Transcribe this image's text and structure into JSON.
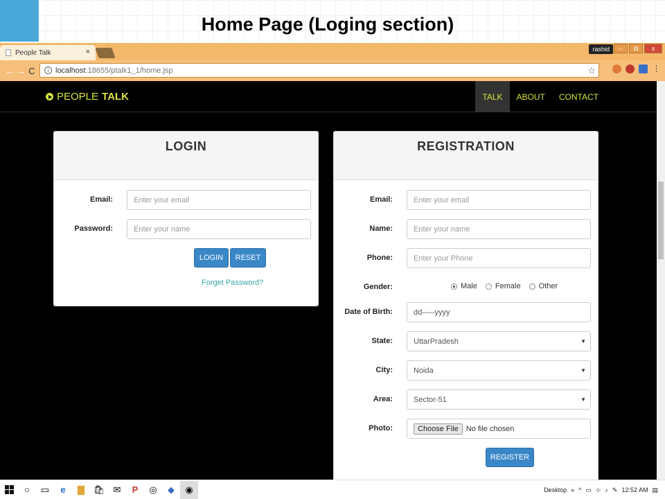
{
  "slide": {
    "title": "Home Page (Loging section)"
  },
  "browser": {
    "tab_title": "People Talk",
    "tab_close": "×",
    "user": "rashid",
    "url_host": "localhost",
    "url_path": ":18655/ptalk1_1/home.jsp",
    "win_min": "–",
    "win_max": "⧉",
    "win_close": "x"
  },
  "navbar": {
    "brand_light": "PEOPLE",
    "brand_bold": "TALK",
    "menu": [
      "TALK",
      "ABOUT",
      "CONTACT"
    ],
    "active": "TALK"
  },
  "login": {
    "title": "LOGIN",
    "email_label": "Email:",
    "email_placeholder": "Enter your email",
    "password_label": "Password:",
    "password_placeholder": "Enter your name",
    "login_button": "LOGIN",
    "reset_button": "RESET",
    "forgot_link": "Forget Password?"
  },
  "registration": {
    "title": "REGISTRATION",
    "email_label": "Email:",
    "email_placeholder": "Enter your email",
    "name_label": "Name:",
    "name_placeholder": "Enter your name",
    "phone_label": "Phone:",
    "phone_placeholder": "Enter your Phone",
    "gender_label": "Gender:",
    "gender_options": [
      "Male",
      "Female",
      "Other"
    ],
    "gender_selected": "Male",
    "dob_label": "Date of Birth:",
    "dob_value": "dd-----yyyy",
    "state_label": "State:",
    "state_value": "UttarPradesh",
    "city_label": "City:",
    "city_value": "Noida",
    "area_label": "Area:",
    "area_value": "Sector-51",
    "photo_label": "Photo:",
    "choose_file": "Choose File",
    "no_file": "No file chosen",
    "register_button": "REGISTER"
  },
  "taskbar": {
    "desktop_label": "Desktop",
    "time": "12:52 AM",
    "overflow": "»"
  },
  "colors": {
    "accent": "#d6e33a",
    "button": "#3a87c8",
    "link": "#3aa6a6",
    "browser_chrome": "#f6c07c"
  }
}
